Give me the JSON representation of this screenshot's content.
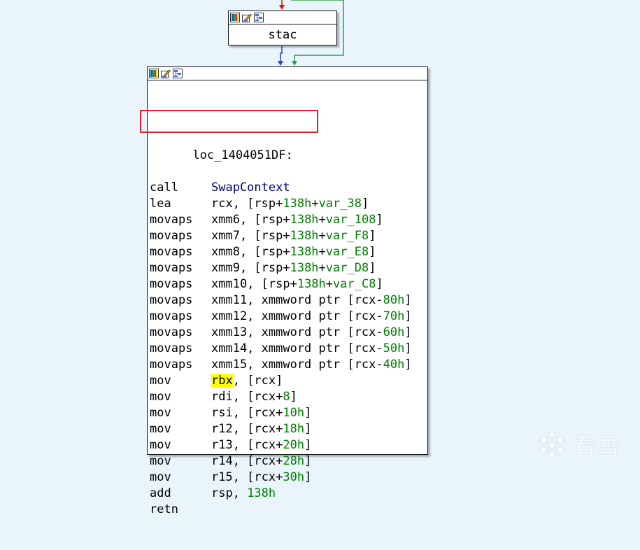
{
  "graph": {
    "small_node": {
      "label": "stac"
    },
    "main_node": {
      "label_line": "loc_1404051DF:",
      "rows": [
        [
          {
            "t": "call",
            "c": "m"
          },
          {
            "t": "SwapContext",
            "c": "navy"
          }
        ],
        [
          {
            "t": "lea",
            "c": "m"
          },
          {
            "t": "rcx, [rsp+"
          },
          {
            "t": "138h",
            "c": "grn"
          },
          {
            "t": "+"
          },
          {
            "t": "var_38",
            "c": "grn"
          },
          {
            "t": "]"
          }
        ],
        [
          {
            "t": "movaps",
            "c": "m"
          },
          {
            "t": "xmm6, [rsp+"
          },
          {
            "t": "138h",
            "c": "grn"
          },
          {
            "t": "+"
          },
          {
            "t": "var_108",
            "c": "grn"
          },
          {
            "t": "]"
          }
        ],
        [
          {
            "t": "movaps",
            "c": "m"
          },
          {
            "t": "xmm7, [rsp+"
          },
          {
            "t": "138h",
            "c": "grn"
          },
          {
            "t": "+"
          },
          {
            "t": "var_F8",
            "c": "grn"
          },
          {
            "t": "]"
          }
        ],
        [
          {
            "t": "movaps",
            "c": "m"
          },
          {
            "t": "xmm8, [rsp+"
          },
          {
            "t": "138h",
            "c": "grn"
          },
          {
            "t": "+"
          },
          {
            "t": "var_E8",
            "c": "grn"
          },
          {
            "t": "]"
          }
        ],
        [
          {
            "t": "movaps",
            "c": "m"
          },
          {
            "t": "xmm9, [rsp+"
          },
          {
            "t": "138h",
            "c": "grn"
          },
          {
            "t": "+"
          },
          {
            "t": "var_D8",
            "c": "grn"
          },
          {
            "t": "]"
          }
        ],
        [
          {
            "t": "movaps",
            "c": "m"
          },
          {
            "t": "xmm10, [rsp+"
          },
          {
            "t": "138h",
            "c": "grn"
          },
          {
            "t": "+"
          },
          {
            "t": "var_C8",
            "c": "grn"
          },
          {
            "t": "]"
          }
        ],
        [
          {
            "t": "movaps",
            "c": "m"
          },
          {
            "t": "xmm11, xmmword ptr [rcx-"
          },
          {
            "t": "80h",
            "c": "grn"
          },
          {
            "t": "]"
          }
        ],
        [
          {
            "t": "movaps",
            "c": "m"
          },
          {
            "t": "xmm12, xmmword ptr [rcx-"
          },
          {
            "t": "70h",
            "c": "grn"
          },
          {
            "t": "]"
          }
        ],
        [
          {
            "t": "movaps",
            "c": "m"
          },
          {
            "t": "xmm13, xmmword ptr [rcx-"
          },
          {
            "t": "60h",
            "c": "grn"
          },
          {
            "t": "]"
          }
        ],
        [
          {
            "t": "movaps",
            "c": "m"
          },
          {
            "t": "xmm14, xmmword ptr [rcx-"
          },
          {
            "t": "50h",
            "c": "grn"
          },
          {
            "t": "]"
          }
        ],
        [
          {
            "t": "movaps",
            "c": "m"
          },
          {
            "t": "xmm15, xmmword ptr [rcx-"
          },
          {
            "t": "40h",
            "c": "grn"
          },
          {
            "t": "]"
          }
        ],
        [
          {
            "t": "mov",
            "c": "m"
          },
          {
            "t": "rbx",
            "c": "hl"
          },
          {
            "t": ", [rcx]"
          }
        ],
        [
          {
            "t": "mov",
            "c": "m"
          },
          {
            "t": "rdi, [rcx+"
          },
          {
            "t": "8",
            "c": "grn"
          },
          {
            "t": "]"
          }
        ],
        [
          {
            "t": "mov",
            "c": "m"
          },
          {
            "t": "rsi, [rcx+"
          },
          {
            "t": "10h",
            "c": "grn"
          },
          {
            "t": "]"
          }
        ],
        [
          {
            "t": "mov",
            "c": "m"
          },
          {
            "t": "r12, [rcx+"
          },
          {
            "t": "18h",
            "c": "grn"
          },
          {
            "t": "]"
          }
        ],
        [
          {
            "t": "mov",
            "c": "m"
          },
          {
            "t": "r13, [rcx+"
          },
          {
            "t": "20h",
            "c": "grn"
          },
          {
            "t": "]"
          }
        ],
        [
          {
            "t": "mov",
            "c": "m"
          },
          {
            "t": "r14, [rcx+"
          },
          {
            "t": "28h",
            "c": "grn"
          },
          {
            "t": "]"
          }
        ],
        [
          {
            "t": "mov",
            "c": "m"
          },
          {
            "t": "r15, [rcx+"
          },
          {
            "t": "30h",
            "c": "grn"
          },
          {
            "t": "]"
          }
        ],
        [
          {
            "t": "add",
            "c": "m"
          },
          {
            "t": "rsp, "
          },
          {
            "t": "138h",
            "c": "grn"
          }
        ],
        [
          {
            "t": "retn",
            "c": "m"
          }
        ]
      ]
    },
    "node_toolbar_icons": [
      "color-palette-icon",
      "edit-node-icon",
      "graph-view-icon"
    ]
  },
  "watermark": {
    "text": "看雪",
    "icon": "snowflake-logo-icon"
  },
  "colors": {
    "background": "#e9f4fb",
    "border": "#1a1a1a",
    "name_ref": "#000080",
    "number": "#008000",
    "highlight": "#ffff00",
    "annotation_box": "#e0202a",
    "edge_red": "#ff0000",
    "edge_blue": "#2a3fd8",
    "edge_green": "#2aa048"
  }
}
